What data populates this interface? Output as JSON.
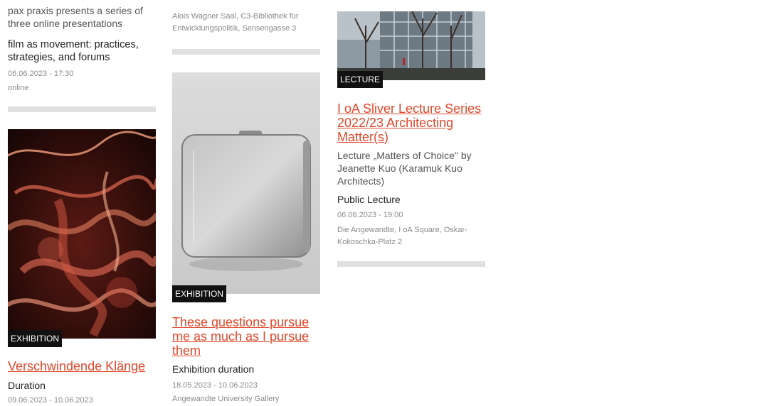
{
  "col1": {
    "top_desc": "pax praxis presents a series of three online presentations",
    "top_type": "film as movement: practices, strategies, and forums",
    "top_date": "06.06.2023 - 17:30",
    "top_place": "online",
    "card": {
      "badge": "EXHIBITION",
      "title": "Verschwindende Klänge",
      "type": "Duration",
      "date": "09.06.2023 - 10.06.2023"
    }
  },
  "col2": {
    "top_place": "Alois Wagner Saal, C3-Bibliothek für Entwicklungspolitik, Sensengasse 3",
    "card": {
      "badge": "EXHIBITION",
      "title": "These questions pursue me as much as I pursue them",
      "type": "Exhibition duration",
      "date": "18.05.2023 - 10.06.2023",
      "place": "Angewandte University Gallery"
    }
  },
  "col3": {
    "card": {
      "badge": "LECTURE",
      "title": "I oA Sliver Lecture Series 2022/23 Architecting Matter(s)",
      "desc": "Lecture „Matters of Choice\" by Jeanette Kuo (Karamuk Kuo Architects)",
      "type": "Public Lecture",
      "date": "06.06.2023 - 19:00",
      "place": "Die Angewandte, I oA Square, Oskar-Kokoschka-Platz 2"
    }
  }
}
